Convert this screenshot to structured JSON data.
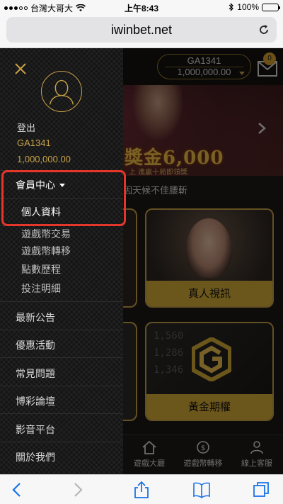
{
  "status_bar": {
    "carrier": "台灣大哥大",
    "time": "上午8:43",
    "battery": "100%"
  },
  "browser": {
    "url": "iwinbet.net"
  },
  "header": {
    "account_id": "GA1341",
    "balance": "1,000,000.00",
    "mail_badge": "0"
  },
  "banner": {
    "headline": "獎金6,000",
    "subline": "上 進贏十局即領獎"
  },
  "marquee": {
    "text": "因天候不佳腰斬"
  },
  "cards": [
    {
      "label": "真人視訊"
    },
    {
      "label": "黃金期權"
    }
  ],
  "gold_ticker": [
    "1,560",
    "1,286",
    "1,346"
  ],
  "bottom_nav": [
    {
      "label": "遊戲大廳",
      "icon": "home-icon",
      "active": true
    },
    {
      "label": "遊戲幣轉移",
      "icon": "coin-transfer-icon"
    },
    {
      "label": "線上客服",
      "icon": "support-agent-icon"
    }
  ],
  "drawer": {
    "login_label": "登出",
    "user_id": "GA1341",
    "balance": "1,000,000.00",
    "member_center": "會員中心",
    "sub_items": [
      "個人資料",
      "遊戲幣交易",
      "遊戲幣轉移",
      "點數歷程",
      "投注明細"
    ],
    "menu_items": [
      "最新公告",
      "優惠活動",
      "常見問題",
      "博彩論壇",
      "影音平台",
      "關於我們"
    ]
  },
  "colors": {
    "gold": "#c7a147",
    "highlight": "#e5362b"
  }
}
